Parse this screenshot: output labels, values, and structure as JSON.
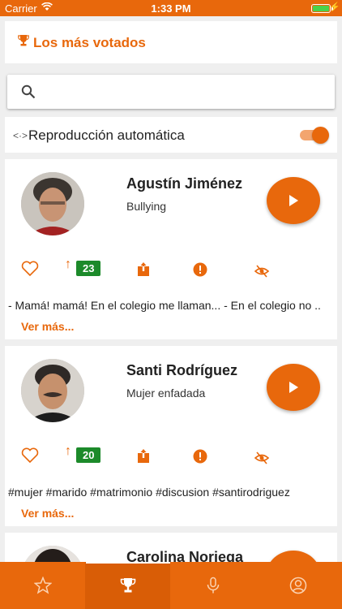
{
  "status_bar": {
    "carrier": "Carrier",
    "time": "1:33 PM"
  },
  "header": {
    "icon": "trophy-icon",
    "title": "Los más votados"
  },
  "search": {
    "placeholder": "",
    "value": ""
  },
  "autoplay": {
    "icon": "code-arrows-icon",
    "label": "Reproducción automática",
    "enabled": true
  },
  "accent_color": "#e8680c",
  "cards": [
    {
      "name": "Agustín Jiménez",
      "subtitle": "Bullying",
      "votes": "23",
      "description": "- Mamá! mamá! En el colegio me llaman... - En el colegio no ..",
      "more_label": "Ver más..."
    },
    {
      "name": "Santi Rodríguez",
      "subtitle": "Mujer enfadada",
      "votes": "20",
      "description": "#mujer #marido #matrimonio #discusion #santirodriguez",
      "more_label": "Ver más..."
    },
    {
      "name": "Carolina Noriega"
    }
  ],
  "tabs": [
    {
      "icon": "star-icon",
      "active": false
    },
    {
      "icon": "trophy-icon",
      "active": true
    },
    {
      "icon": "microphone-icon",
      "active": false
    },
    {
      "icon": "profile-icon",
      "active": false
    }
  ]
}
